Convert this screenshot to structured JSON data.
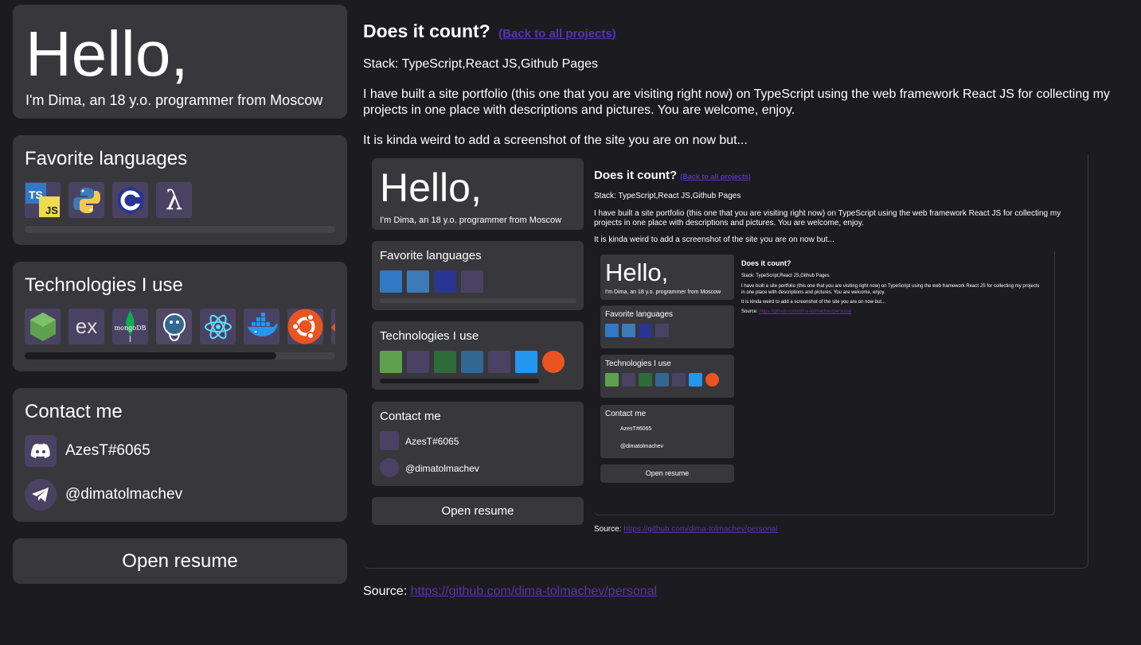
{
  "hello": {
    "title": "Hello,",
    "subtitle": "I'm Dima, an 18 y.o. programmer from Moscow"
  },
  "languages": {
    "title": "Favorite languages",
    "items": [
      "typescript-javascript-icon",
      "python-icon",
      "c-icon",
      "lambda-icon"
    ],
    "scroll_fraction": 0.0
  },
  "technologies": {
    "title": "Technologies I use",
    "items": [
      "nodejs-icon",
      "express-icon",
      "mongodb-icon",
      "postgresql-icon",
      "react-icon",
      "docker-icon",
      "ubuntu-icon"
    ],
    "scroll_fraction": 0.81
  },
  "contact": {
    "title": "Contact me",
    "discord": "AzesT#6065",
    "telegram": "@dimatolmachev"
  },
  "resume_label": "Open resume",
  "project": {
    "title": "Does it count?",
    "back_link": "(Back to all projects)",
    "stack": "Stack: TypeScript,React JS,Github Pages",
    "description": "I have built a site portfolio (this one that you are visiting right now) on TypeScript using the web framework React JS for collecting my projects in one place with descriptions and pictures. You are welcome, enjoy.",
    "note": "It is kinda weird to add a screenshot of the site you are on now but...",
    "source_label": "Source:",
    "source_url": "https://github.com/dima-tolmachev/personal",
    "nested_link_text": "(Back to all projects)"
  },
  "colors": {
    "background": "#1c1b20",
    "card": "#38373c",
    "tile": "#4a4262",
    "link": "#5a35a8"
  }
}
